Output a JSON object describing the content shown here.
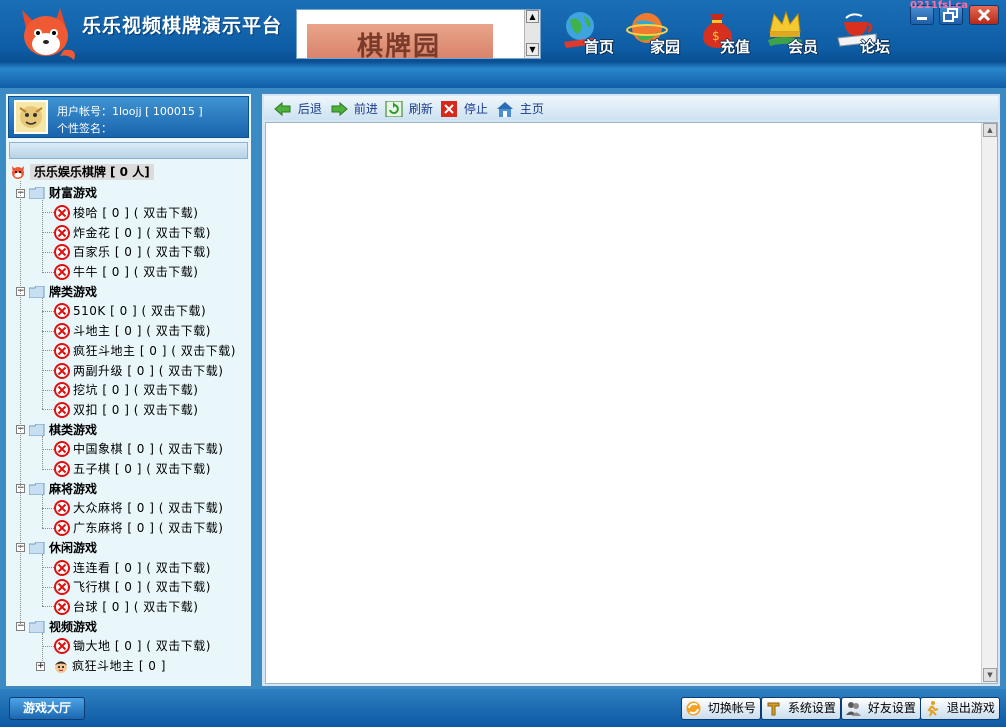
{
  "header": {
    "app_title": "乐乐视频棋牌演示平台",
    "ad_text": "棋牌园",
    "nav": [
      {
        "label": "首页",
        "icon": "globe-icon"
      },
      {
        "label": "家园",
        "icon": "planet-icon"
      },
      {
        "label": "充值",
        "icon": "money-bag-icon"
      },
      {
        "label": "会员",
        "icon": "crown-icon"
      },
      {
        "label": "论坛",
        "icon": "teacup-icon"
      }
    ],
    "pink_label": "0211fsl.ca"
  },
  "user": {
    "account_line": "用户帐号：1loojj [ 100015 ]",
    "signature_line": "个性签名："
  },
  "tree": {
    "root": "乐乐娱乐棋牌 [ 0 人]",
    "groups": [
      {
        "label": "财富游戏",
        "items": [
          "梭哈 [ 0 ] ( 双击下载)",
          "炸金花 [ 0 ] ( 双击下载)",
          "百家乐 [ 0 ] ( 双击下载)",
          "牛牛 [ 0 ] ( 双击下载)"
        ]
      },
      {
        "label": "牌类游戏",
        "items": [
          "510K [ 0 ] ( 双击下载)",
          "斗地主 [ 0 ] ( 双击下载)",
          "疯狂斗地主 [ 0 ] ( 双击下载)",
          "两副升级 [ 0 ] ( 双击下载)",
          "挖坑 [ 0 ] ( 双击下载)",
          "双扣 [ 0 ] ( 双击下载)"
        ]
      },
      {
        "label": "棋类游戏",
        "items": [
          "中国象棋 [ 0 ] ( 双击下载)",
          "五子棋 [ 0 ] ( 双击下载)"
        ]
      },
      {
        "label": "麻将游戏",
        "items": [
          "大众麻将 [ 0 ] ( 双击下载)",
          "广东麻将 [ 0 ] ( 双击下载)"
        ]
      },
      {
        "label": "休闲游戏",
        "items": [
          "连连看 [ 0 ] ( 双击下载)",
          "飞行棋 [ 0 ] ( 双击下载)",
          "台球 [ 0 ] ( 双击下载)"
        ]
      },
      {
        "label": "视频游戏",
        "items": [
          "锄大地 [ 0 ] ( 双击下载)"
        ],
        "extra_item": "疯狂斗地主 [ 0 ]"
      }
    ]
  },
  "browser": {
    "back": "后退",
    "forward": "前进",
    "refresh": "刷新",
    "stop": "停止",
    "home": "主页"
  },
  "bottom": {
    "lobby": "游戏大厅",
    "switch_account": "切换帐号",
    "system_settings": "系统设置",
    "friend_settings": "好友设置",
    "exit_game": "退出游戏"
  },
  "colors": {
    "header_blue": "#0e5da5",
    "panel_bg": "#e9f7fb",
    "error_red": "#e01010"
  }
}
